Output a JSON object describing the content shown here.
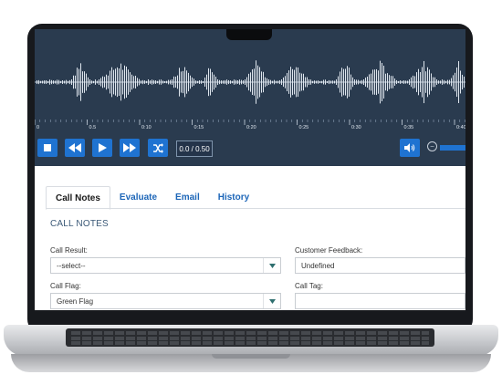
{
  "player": {
    "timeline_ticks": [
      "0",
      "0.5",
      "0:10",
      "0:15",
      "0:20",
      "0:25",
      "0:30",
      "0:35",
      "0:40"
    ],
    "time_display": "0.0 / 0.50",
    "controls": {
      "stop": "stop-icon",
      "rewind": "rewind-icon",
      "play": "play-icon",
      "fast_forward": "fast-forward-icon",
      "shuffle": "shuffle-icon",
      "volume": "speaker-icon",
      "volume_down": "minus-icon"
    },
    "colors": {
      "background": "#2a3b4f",
      "button": "#1f73d1",
      "wave": "#dfe6ee"
    }
  },
  "tabs": [
    "Call Notes",
    "Evaluate",
    "Email",
    "History"
  ],
  "call_notes": {
    "section_title": "CALL NOTES",
    "call_result": {
      "label": "Call Result:",
      "value": "--select--"
    },
    "customer_feedback": {
      "label": "Customer Feedback:",
      "value": "Undefined"
    },
    "call_flag": {
      "label": "Call Flag:",
      "value": "Green Flag"
    },
    "call_tag": {
      "label": "Call Tag:",
      "value": ""
    }
  }
}
